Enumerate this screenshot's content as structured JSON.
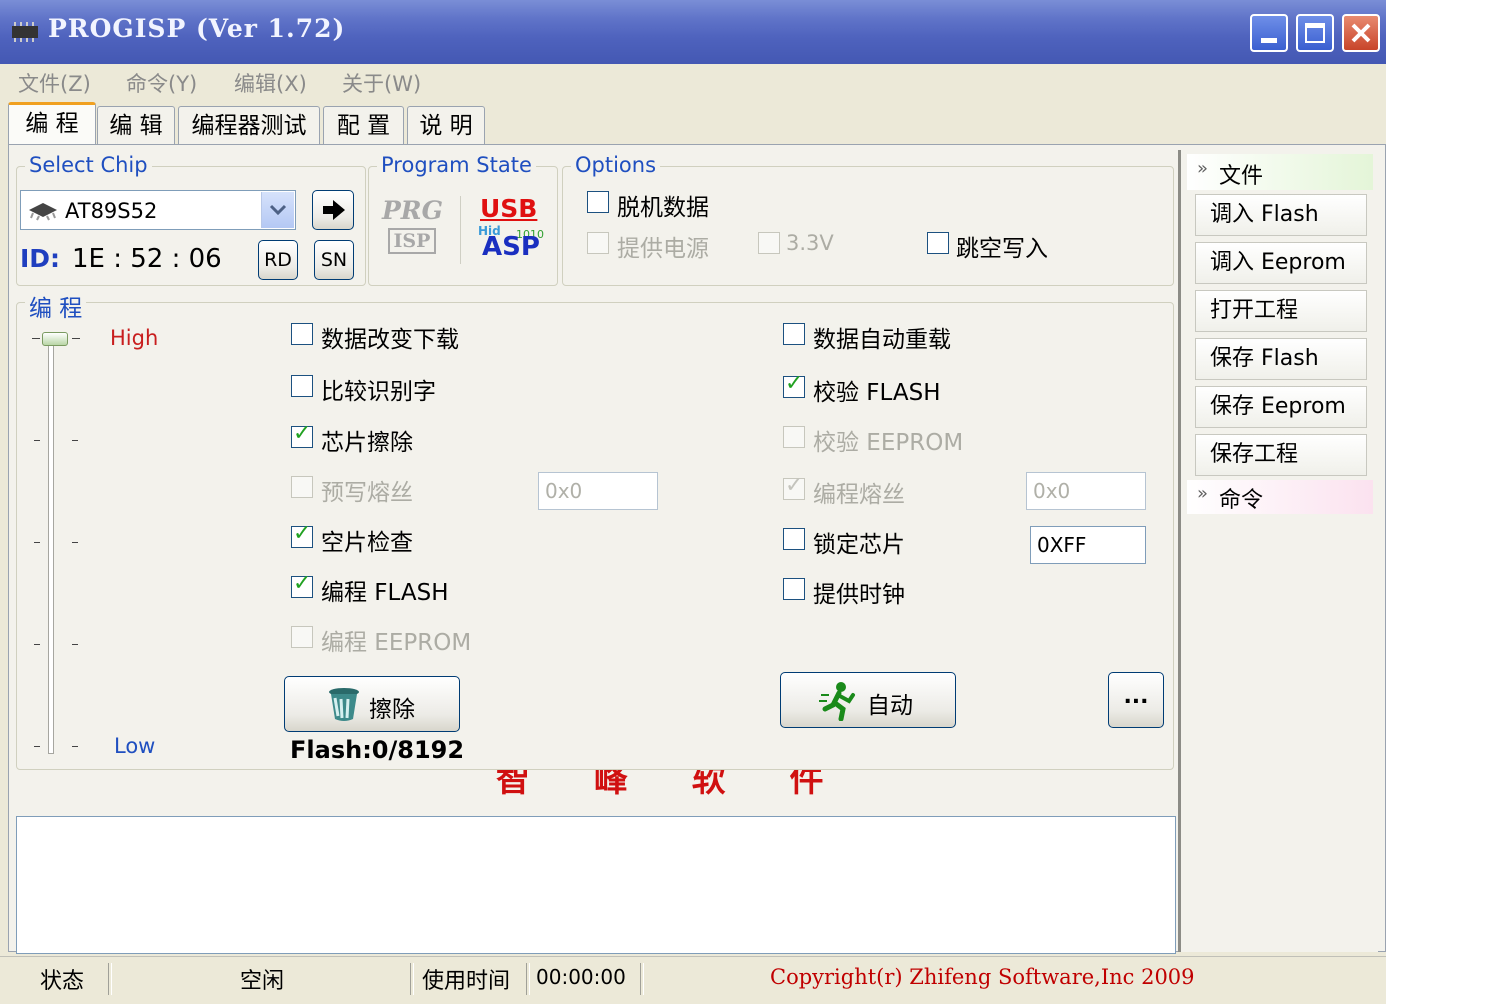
{
  "window": {
    "title": "PROGISP (Ver 1.72)",
    "menu": [
      "文件(Z)",
      "命令(Y)",
      "编辑(X)",
      "关于(W)"
    ],
    "tabs": [
      "编 程",
      "编 辑",
      "编程器测试",
      "配 置",
      "说 明"
    ]
  },
  "select_chip": {
    "title": "Select Chip",
    "chip": "AT89S52",
    "id_label": "ID:",
    "id_value": "1E : 52 : 06",
    "rd_label": "RD",
    "sn_label": "SN"
  },
  "program_state": {
    "title": "Program State",
    "logo_left_top": "PRG",
    "logo_left_bottom": "ISP",
    "logo_right_top": "USB",
    "logo_right_small": "Hid",
    "logo_right_bits": "1010",
    "logo_right_bottom": "ASP"
  },
  "options": {
    "title": "Options",
    "offline": "脱机数据",
    "power": "提供电源",
    "v33": "3.3V",
    "skip_blank": "跳空写入"
  },
  "program": {
    "title": "编 程",
    "high": "High",
    "low": "Low",
    "left": [
      {
        "label": "数据改变下载",
        "checked": false,
        "disabled": false
      },
      {
        "label": "比较识别字",
        "checked": false,
        "disabled": false
      },
      {
        "label": "芯片擦除",
        "checked": true,
        "disabled": false
      },
      {
        "label": "预写熔丝",
        "checked": false,
        "disabled": true
      },
      {
        "label": "空片检查",
        "checked": true,
        "disabled": false
      },
      {
        "label": "编程 FLASH",
        "checked": true,
        "disabled": false
      },
      {
        "label": "编程 EEPROM",
        "checked": false,
        "disabled": true
      }
    ],
    "right": [
      {
        "label": "数据自动重载",
        "checked": false,
        "disabled": false
      },
      {
        "label": "校验 FLASH",
        "checked": true,
        "disabled": false
      },
      {
        "label": "校验 EEPROM",
        "checked": false,
        "disabled": true
      },
      {
        "label": "编程熔丝",
        "checked": true,
        "disabled": true
      },
      {
        "label": "锁定芯片",
        "checked": false,
        "disabled": false
      },
      {
        "label": "提供时钟",
        "checked": false,
        "disabled": false
      }
    ],
    "prewrite_value": "0x0",
    "fuse_value": "0x0",
    "lock_value": "0XFF",
    "erase_button": "擦除",
    "auto_button": "自动",
    "more_button": "...",
    "flash_info": "Flash:0/8192",
    "watermark": "智 峰 软 件"
  },
  "side": {
    "file_header": "文件",
    "buttons": [
      "调入 Flash",
      "调入 Eeprom",
      "打开工程",
      "保存 Flash",
      "保存 Eeprom",
      "保存工程"
    ],
    "cmd_header": "命令"
  },
  "status": {
    "state_label": "状态",
    "state_value": "空闲",
    "time_label": "使用时间",
    "time_value": "00:00:00",
    "copyright": "Copyright(r) Zhifeng Software,Inc 2009"
  },
  "colors": {
    "title_gradient": "#4e62bd",
    "group_title": "#1f4fc0",
    "high_label": "#c81e1e",
    "low_label": "#1f4fc0",
    "copyright": "#c00000",
    "check_mark": "#21a121"
  }
}
